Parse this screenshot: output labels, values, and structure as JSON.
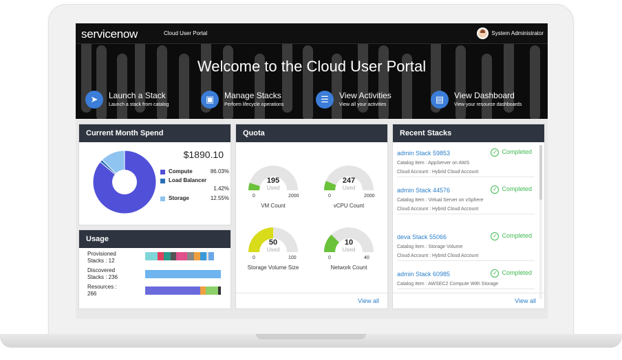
{
  "header": {
    "logo": "servicenow",
    "portal_name": "Cloud User Portal",
    "user_name": "System Administrator",
    "welcome": "Welcome to the Cloud User Portal",
    "actions": [
      {
        "title": "Launch a Stack",
        "subtitle": "Launch a stack from catalog",
        "icon": "rocket-icon"
      },
      {
        "title": "Manage Stacks",
        "subtitle": "Perform lifecycle operations",
        "icon": "cubes-icon"
      },
      {
        "title": "View Activities",
        "subtitle": "View all your activities",
        "icon": "list-icon"
      },
      {
        "title": "View Dashboard",
        "subtitle": "View your resource dashboards",
        "icon": "bar-chart-icon"
      }
    ]
  },
  "spend": {
    "title": "Current Month Spend",
    "total": "$1890.10",
    "legend": [
      {
        "name": "Compute",
        "value": "86.03%",
        "color": "#5050d8"
      },
      {
        "name": "Load Balancer",
        "value": "1.42%",
        "color": "#2a6fb5"
      },
      {
        "name": "Storage",
        "value": "12.55%",
        "color": "#8fc3f0"
      }
    ]
  },
  "chart_data": {
    "type": "pie",
    "categories": [
      "Compute",
      "Load Balancer",
      "Storage"
    ],
    "values": [
      86.03,
      1.42,
      12.55
    ]
  },
  "usage": {
    "title": "Usage",
    "rows": [
      {
        "label": "Provisioned Stacks : 12"
      },
      {
        "label": "Discovered Stacks : 236"
      },
      {
        "label": "Resources : 266"
      }
    ]
  },
  "quota": {
    "title": "Quota",
    "used_label": "Used",
    "gauges": [
      {
        "value": "195",
        "min": "0",
        "max": "2000",
        "caption": "VM Count",
        "fraction": 0.0975,
        "color": "#6ac23a"
      },
      {
        "value": "247",
        "min": "0",
        "max": "2000",
        "caption": "vCPU Count",
        "fraction": 0.1235,
        "color": "#6ac23a"
      },
      {
        "value": "50",
        "min": "0",
        "max": "100",
        "caption": "Storage Volume Size",
        "fraction": 0.5,
        "color": "#d8dc1a"
      },
      {
        "value": "10",
        "min": "0",
        "max": "40",
        "caption": "Network Count",
        "fraction": 0.25,
        "color": "#6ac23a"
      }
    ],
    "view_all": "View all"
  },
  "recent": {
    "title": "Recent Stacks",
    "stacks": [
      {
        "name": "admin Stack 59853",
        "status": "Completed",
        "lines": [
          "Catalog Item : AppServer on AWS",
          "Cloud Account : Hybrid Cloud Account"
        ]
      },
      {
        "name": "admin Stack 44576",
        "status": "Completed",
        "lines": [
          "Catalog Item : Virtual Server on vSphere",
          "Cloud Account : Hybrid Cloud Account"
        ]
      },
      {
        "name": "deva Stack 55066",
        "status": "Completed",
        "lines": [
          "Catalog Item : Storage Volume",
          "Cloud Account : Hybrid Cloud Account"
        ]
      },
      {
        "name": "admin Stack 60985",
        "status": "Completed",
        "lines": [
          "Catalog Item : AWSEC2 Compute With Storage"
        ]
      }
    ],
    "view_all": "View all"
  }
}
